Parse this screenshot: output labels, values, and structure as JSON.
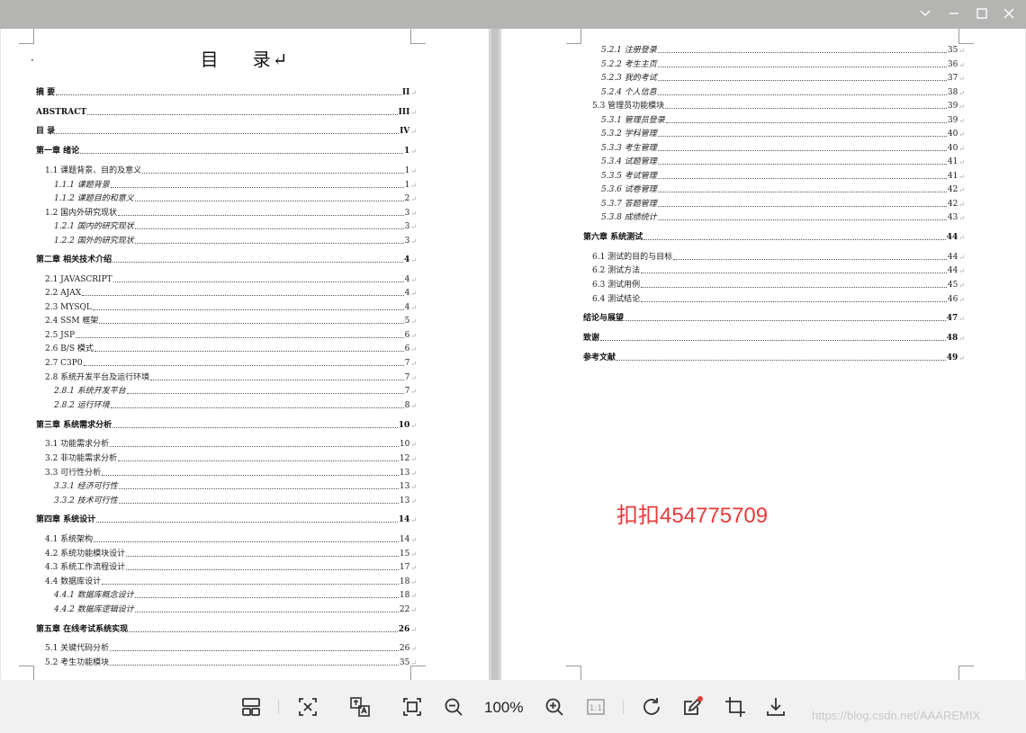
{
  "left_page": {
    "title_a": "目",
    "title_b": "录↵",
    "entries": [
      {
        "label": "摘    要",
        "page": "II",
        "level": "chap"
      },
      {
        "label": "ABSTRACT",
        "page": "III",
        "level": "chap"
      },
      {
        "label": "目    录",
        "page": "IV",
        "level": "chap"
      },
      {
        "label": "第一章  绪论",
        "page": "1",
        "level": "chap"
      },
      {
        "label": "1.1  课题背景、目的及意义",
        "page": "1",
        "level": "sub1"
      },
      {
        "label": "1.1.1  课题背景",
        "page": "1",
        "level": "sub3"
      },
      {
        "label": "1.1.2  课题目的和意义",
        "page": "2",
        "level": "sub3"
      },
      {
        "label": "1.2  国内外研究现状",
        "page": "3",
        "level": "sub1"
      },
      {
        "label": "1.2.1  国内的研究现状",
        "page": "3",
        "level": "sub3"
      },
      {
        "label": "1.2.2  国外的研究现状",
        "page": "3",
        "level": "sub3"
      },
      {
        "label": "第二章  相关技术介绍",
        "page": "4",
        "level": "chap"
      },
      {
        "label": "2.1 JAVASCRIPT",
        "page": "4",
        "level": "sub1"
      },
      {
        "label": "2.2 AJAX",
        "page": "4",
        "level": "sub1"
      },
      {
        "label": "2.3 MYSQL",
        "page": "4",
        "level": "sub1"
      },
      {
        "label": "2.4 SSM 框架",
        "page": "5",
        "level": "sub1"
      },
      {
        "label": "2.5 JSP",
        "page": "6",
        "level": "sub1"
      },
      {
        "label": "2.6 B/S 模式",
        "page": "6",
        "level": "sub1"
      },
      {
        "label": "2.7 C3P0",
        "page": "7",
        "level": "sub1"
      },
      {
        "label": "2.8  系统开发平台及运行环境",
        "page": "7",
        "level": "sub1"
      },
      {
        "label": "2.8.1  系统开发平台",
        "page": "7",
        "level": "sub3"
      },
      {
        "label": "2.8.2  运行环境",
        "page": "8",
        "level": "sub3"
      },
      {
        "label": "第三章  系统需求分析",
        "page": "10",
        "level": "chap"
      },
      {
        "label": "3.1  功能需求分析",
        "page": "10",
        "level": "sub1"
      },
      {
        "label": "3.2  非功能需求分析",
        "page": "12",
        "level": "sub1"
      },
      {
        "label": "3.3  可行性分析",
        "page": "13",
        "level": "sub1"
      },
      {
        "label": "3.3.1  经济可行性",
        "page": "13",
        "level": "sub3"
      },
      {
        "label": "3.3.2  技术可行性",
        "page": "13",
        "level": "sub3"
      },
      {
        "label": "第四章  系统设计",
        "page": "14",
        "level": "chap"
      },
      {
        "label": "4.1  系统架构",
        "page": "14",
        "level": "sub1"
      },
      {
        "label": "4.2  系统功能模块设计",
        "page": "15",
        "level": "sub1"
      },
      {
        "label": "4.3  系统工作流程设计",
        "page": "17",
        "level": "sub1"
      },
      {
        "label": "4.4  数据库设计",
        "page": "18",
        "level": "sub1"
      },
      {
        "label": "4.4.1  数据库概念设计",
        "page": "18",
        "level": "sub3"
      },
      {
        "label": "4.4.2  数据库逻辑设计",
        "page": "22",
        "level": "sub3"
      },
      {
        "label": "第五章  在线考试系统实现",
        "page": "26",
        "level": "chap"
      },
      {
        "label": "5.1  关键代码分析",
        "page": "26",
        "level": "sub1"
      },
      {
        "label": "5.2  考生功能模块",
        "page": "35",
        "level": "sub1"
      }
    ]
  },
  "right_page": {
    "entries": [
      {
        "label": "5.2.1  注册登录",
        "page": "35",
        "level": "sub3"
      },
      {
        "label": "5.2.2  考生主页",
        "page": "36",
        "level": "sub3"
      },
      {
        "label": "5.2.3  我的考试",
        "page": "37",
        "level": "sub3"
      },
      {
        "label": "5.2.4  个人信息",
        "page": "38",
        "level": "sub3"
      },
      {
        "label": "5.3  管理员功能模块",
        "page": "39",
        "level": "sub1"
      },
      {
        "label": "5.3.1  管理员登录",
        "page": "39",
        "level": "sub3"
      },
      {
        "label": "5.3.2  学科管理",
        "page": "40",
        "level": "sub3"
      },
      {
        "label": "5.3.3  考生管理",
        "page": "40",
        "level": "sub3"
      },
      {
        "label": "5.3.4  试题管理",
        "page": "41",
        "level": "sub3"
      },
      {
        "label": "5.3.5  考试管理",
        "page": "41",
        "level": "sub3"
      },
      {
        "label": "5.3.6  试卷管理",
        "page": "42",
        "level": "sub3"
      },
      {
        "label": "5.3.7  答题管理",
        "page": "42",
        "level": "sub3"
      },
      {
        "label": "5.3.8  成绩统计",
        "page": "43",
        "level": "sub3"
      },
      {
        "label": "第六章  系统测试",
        "page": "44",
        "level": "chap"
      },
      {
        "label": "6.1  测试的目的与目标",
        "page": "44",
        "level": "sub1"
      },
      {
        "label": "6.2  测试方法",
        "page": "44",
        "level": "sub1"
      },
      {
        "label": "6.3  测试用例",
        "page": "45",
        "level": "sub1"
      },
      {
        "label": "6.4  测试结论",
        "page": "46",
        "level": "sub1"
      },
      {
        "label": "结论与展望",
        "page": "47",
        "level": "chap"
      },
      {
        "label": "致谢",
        "page": "48",
        "level": "chap"
      },
      {
        "label": "参考文献",
        "page": "49",
        "level": "chap"
      }
    ],
    "overlay_text": "扣扣454775709"
  },
  "toolbar": {
    "zoom_level": "100%",
    "icons": [
      "layout-icon",
      "fit-width-icon",
      "translate-icon",
      "fit-page-icon",
      "zoom-out-icon",
      "zoom-in-icon",
      "actual-size-icon",
      "rotate-icon",
      "annotate-icon",
      "crop-icon",
      "download-icon"
    ]
  },
  "site_watermark": "https://blog.csdn.net/AAAREMIX",
  "ret_mark": "↵"
}
